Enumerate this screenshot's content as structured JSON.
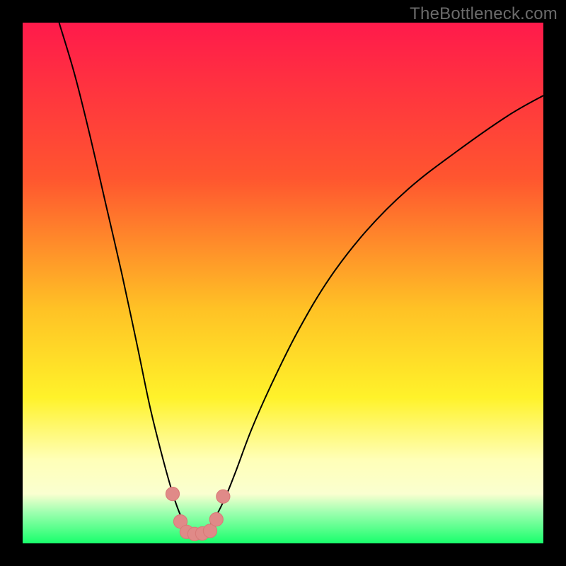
{
  "watermark": {
    "text": "TheBottleneck.com"
  },
  "colors": {
    "top": "#ff1a4b",
    "mid1": "#ff8b2b",
    "mid2": "#ffe024",
    "pale": "#ffffb0",
    "green": "#2bff70",
    "curve": "#000000",
    "marker": "#d97a78",
    "marker_fill": "#e08a88"
  },
  "chart_data": {
    "type": "line",
    "title": "",
    "xlabel": "",
    "ylabel": "",
    "xlim": [
      0,
      100
    ],
    "ylim": [
      0,
      100
    ],
    "gradient_stops": [
      {
        "offset": 0.0,
        "color": "#ff1a4b"
      },
      {
        "offset": 0.3,
        "color": "#ff562f"
      },
      {
        "offset": 0.55,
        "color": "#ffc225"
      },
      {
        "offset": 0.72,
        "color": "#fff22a"
      },
      {
        "offset": 0.84,
        "color": "#ffffb8"
      },
      {
        "offset": 0.905,
        "color": "#faffd0"
      },
      {
        "offset": 0.94,
        "color": "#9fffb0"
      },
      {
        "offset": 1.0,
        "color": "#18ff6c"
      }
    ],
    "series": [
      {
        "name": "bottleneck-curve",
        "x": [
          7,
          10,
          13,
          16,
          19,
          22,
          24.5,
          27,
          29,
          30.5,
          31.8,
          33,
          34.2,
          35.5,
          37,
          39,
          41,
          44,
          48,
          53,
          59,
          66,
          74,
          83,
          93,
          100
        ],
        "y": [
          100,
          90,
          78,
          65,
          52,
          38,
          26,
          16,
          9,
          5,
          3,
          2.5,
          2.5,
          3,
          5,
          9,
          14,
          22,
          31,
          41,
          51,
          60,
          68,
          75,
          82,
          86
        ]
      }
    ],
    "markers": {
      "name": "highlight-points",
      "x": [
        28.8,
        30.3,
        31.5,
        33.0,
        34.5,
        36.0,
        37.2,
        38.5
      ],
      "y": [
        9.5,
        4.2,
        2.2,
        1.8,
        1.9,
        2.4,
        4.6,
        9.0
      ],
      "r": 1.3
    }
  }
}
